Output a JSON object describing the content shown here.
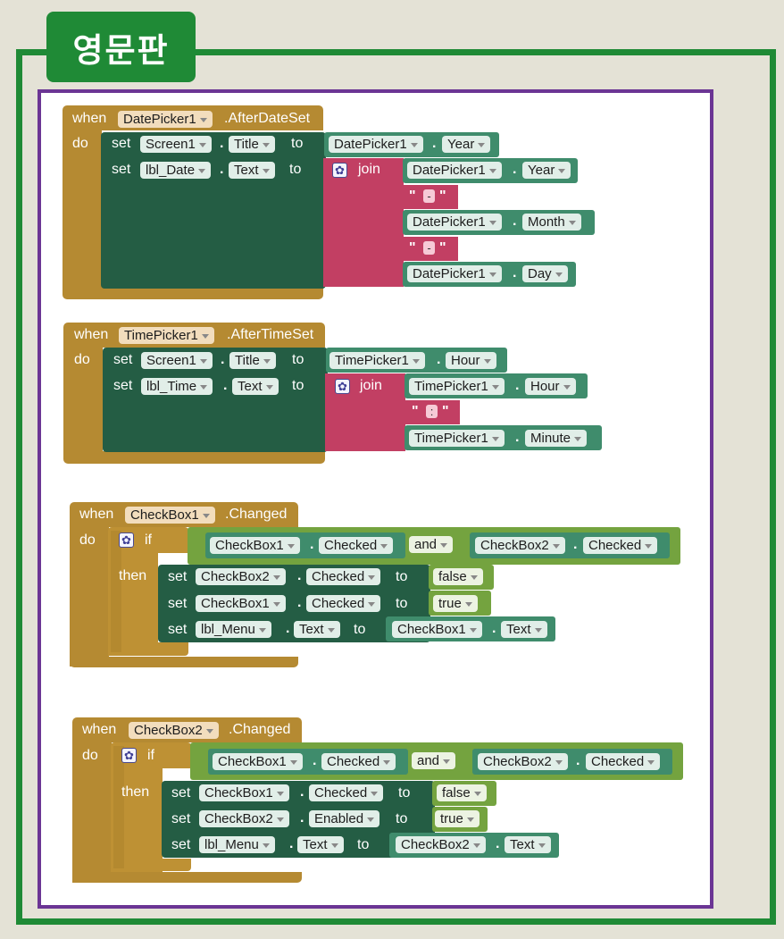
{
  "header": {
    "title": "영문판"
  },
  "blocks": {
    "b1": {
      "when": "when",
      "component": "DatePicker1",
      "event": ".AfterDateSet",
      "do": "do",
      "set1": {
        "set": "set",
        "comp": "Screen1",
        "prop": "Title",
        "to": "to",
        "vcomp": "DatePicker1",
        "vprop": "Year"
      },
      "set2": {
        "set": "set",
        "comp": "lbl_Date",
        "prop": "Text",
        "to": "to",
        "join": "join",
        "items": [
          {
            "comp": "DatePicker1",
            "prop": "Year"
          },
          {
            "str": "-"
          },
          {
            "comp": "DatePicker1",
            "prop": "Month"
          },
          {
            "str": "-"
          },
          {
            "comp": "DatePicker1",
            "prop": "Day"
          }
        ]
      }
    },
    "b2": {
      "when": "when",
      "component": "TimePicker1",
      "event": ".AfterTimeSet",
      "do": "do",
      "set1": {
        "set": "set",
        "comp": "Screen1",
        "prop": "Title",
        "to": "to",
        "vcomp": "TimePicker1",
        "vprop": "Hour"
      },
      "set2": {
        "set": "set",
        "comp": "lbl_Time",
        "prop": "Text",
        "to": "to",
        "join": "join",
        "items": [
          {
            "comp": "TimePicker1",
            "prop": "Hour"
          },
          {
            "str": ":"
          },
          {
            "comp": "TimePicker1",
            "prop": "Minute"
          }
        ]
      }
    },
    "b3": {
      "when": "when",
      "component": "CheckBox1",
      "event": ".Changed",
      "do": "do",
      "if": "if",
      "then": "then",
      "cond": {
        "a_comp": "CheckBox1",
        "a_prop": "Checked",
        "op": "and",
        "b_comp": "CheckBox2",
        "b_prop": "Checked"
      },
      "rows": [
        {
          "set": "set",
          "comp": "CheckBox2",
          "prop": "Checked",
          "to": "to",
          "value": "false"
        },
        {
          "set": "set",
          "comp": "CheckBox1",
          "prop": "Checked",
          "to": "to",
          "value": "true"
        },
        {
          "set": "set",
          "comp": "lbl_Menu",
          "prop": "Text",
          "to": "to",
          "vcomp": "CheckBox1",
          "vprop": "Text"
        }
      ]
    },
    "b4": {
      "when": "when",
      "component": "CheckBox2",
      "event": ".Changed",
      "do": "do",
      "if": "if",
      "then": "then",
      "cond": {
        "a_comp": "CheckBox1",
        "a_prop": "Checked",
        "op": "and",
        "b_comp": "CheckBox2",
        "b_prop": "Checked"
      },
      "rows": [
        {
          "set": "set",
          "comp": "CheckBox1",
          "prop": "Checked",
          "to": "to",
          "value": "false"
        },
        {
          "set": "set",
          "comp": "CheckBox2",
          "prop": "Enabled",
          "to": "to",
          "value": "true"
        },
        {
          "set": "set",
          "comp": "lbl_Menu",
          "prop": "Text",
          "to": "to",
          "vcomp": "CheckBox2",
          "vprop": "Text"
        }
      ]
    }
  },
  "colors": {
    "frame": "#1f8a36",
    "canvas_border": "#6b3594",
    "event_block": "#b58a32",
    "setter_block": "#245d44",
    "join_block": "#c23f63",
    "getter_block": "#3f8c6c",
    "logic_block": "#74a33f"
  }
}
